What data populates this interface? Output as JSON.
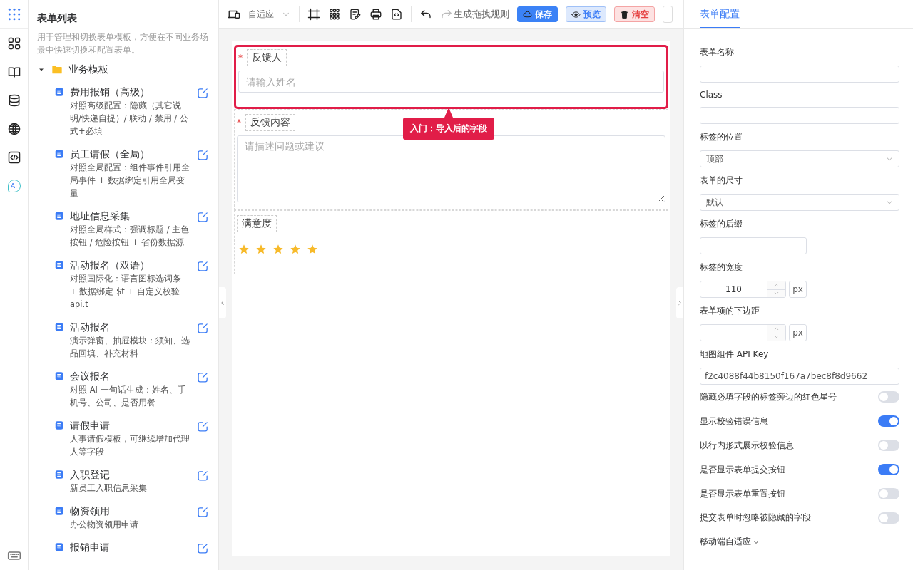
{
  "rail": {
    "ai_badge": "AI"
  },
  "left_panel": {
    "title": "表单列表",
    "description": "用于管理和切换表单模板，方便在不同业务场景中快速切换和配置表单。",
    "folder": {
      "label": "业务模板",
      "expanded": true,
      "children": [
        {
          "title": "费用报销（高级）",
          "description": "对照高级配置：隐藏（其它说明/快递自提）/ 联动 / 禁用 / 公式+必填"
        },
        {
          "title": "员工请假（全局）",
          "description": "对照全局配置：组件事件引用全局事件 + 数据绑定引用全局变量"
        },
        {
          "title": "地址信息采集",
          "description": "对照全局样式：强调标题 / 主色按钮 / 危险按钮 + 省份数据源"
        },
        {
          "title": "活动报名（双语）",
          "description": "对照国际化：语言图标选词条 + 数据绑定 $t + 自定义校验 api.t"
        },
        {
          "title": "活动报名",
          "description": "演示弹窗、抽屉模块：须知、选品回填、补充材料"
        },
        {
          "title": "会议报名",
          "description": "对照 AI 一句话生成：姓名、手机号、公司、是否用餐"
        },
        {
          "title": "请假申请",
          "description": "人事请假模板，可继续增加代理人等字段"
        },
        {
          "title": "入职登记",
          "description": "新员工入职信息采集"
        },
        {
          "title": "物资领用",
          "description": "办公物资领用申请"
        },
        {
          "title": "报销申请"
        }
      ]
    }
  },
  "toolbar": {
    "device_select": "自适应",
    "rule_button": "生成拖拽规则",
    "undo_disabled": false,
    "redo_disabled": true,
    "buttons": [
      {
        "label": "保存",
        "kind": "primary"
      },
      {
        "label": "预览",
        "kind": "info"
      },
      {
        "label": "清空",
        "kind": "danger"
      }
    ]
  },
  "canvas": {
    "fields": [
      {
        "kind": "input",
        "label": "反馈人",
        "required_mark": "*",
        "placeholder": "请输入姓名",
        "selected": true
      },
      {
        "kind": "textarea",
        "label": "反馈内容",
        "required_mark": "*",
        "placeholder": "请描述问题或建议",
        "selected": false
      },
      {
        "kind": "rate",
        "label": "满意度",
        "stars": 5,
        "selected": false
      }
    ],
    "tooltip": "入门：导入后的字段"
  },
  "config_panel": {
    "tabs": [
      {
        "label": "表单配置",
        "selected": true
      }
    ],
    "items": [
      {
        "kind": "text",
        "label": "表单名称"
      },
      {
        "kind": "text",
        "label": "Class"
      },
      {
        "kind": "select",
        "label": "标签的位置",
        "value": "顶部"
      },
      {
        "kind": "select",
        "label": "表单的尺寸",
        "value": "默认"
      },
      {
        "kind": "short",
        "label": "标签的后缀"
      },
      {
        "kind": "number",
        "label": "标签的宽度",
        "value": "110",
        "suffix": "px"
      },
      {
        "kind": "number",
        "label": "表单项的下边距",
        "suffix": "px"
      },
      {
        "kind": "text",
        "label": "地图组件 API Key",
        "value": "f2c4088f44b8150f167a7bec8f8d9662"
      },
      {
        "kind": "switch",
        "label": "隐藏必填字段的标签旁边的红色星号",
        "on": false
      },
      {
        "kind": "switch",
        "label": "显示校验错误信息",
        "on": true
      },
      {
        "kind": "switch",
        "label": "以行内形式展示校验信息",
        "on": false
      },
      {
        "kind": "switch",
        "label": "是否显示表单提交按钮",
        "on": true
      },
      {
        "kind": "switch",
        "label": "是否显示表单重置按钮",
        "on": false
      },
      {
        "kind": "switch",
        "label": "提交表单时忽略被隐藏的字段",
        "on": false,
        "hint": true
      },
      {
        "kind": "collapse",
        "label": "移动端自适应",
        "expanded": false
      }
    ]
  }
}
